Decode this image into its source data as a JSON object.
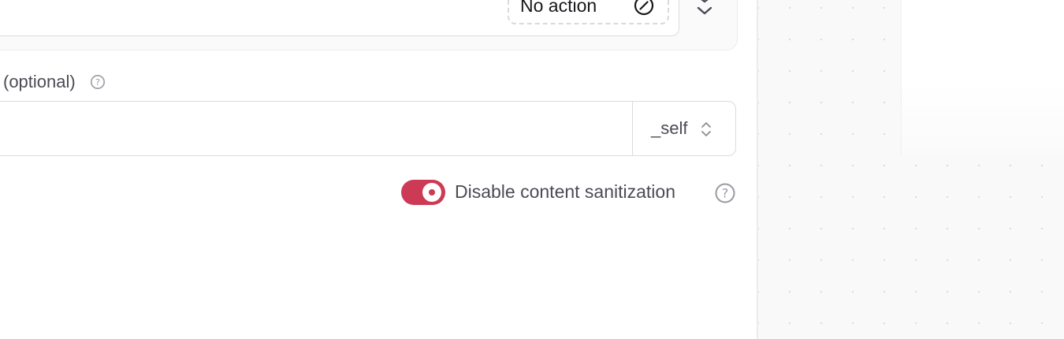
{
  "action_chip": {
    "label": "No action",
    "icon": "no-action-icon"
  },
  "link_field": {
    "label": "(optional)",
    "target_value": "_self"
  },
  "sanitization": {
    "label": "Disable content sanitization",
    "enabled": true
  },
  "colors": {
    "accent": "#cc3a55",
    "border": "#dcdce0",
    "canvas": "#f9f9f9"
  }
}
